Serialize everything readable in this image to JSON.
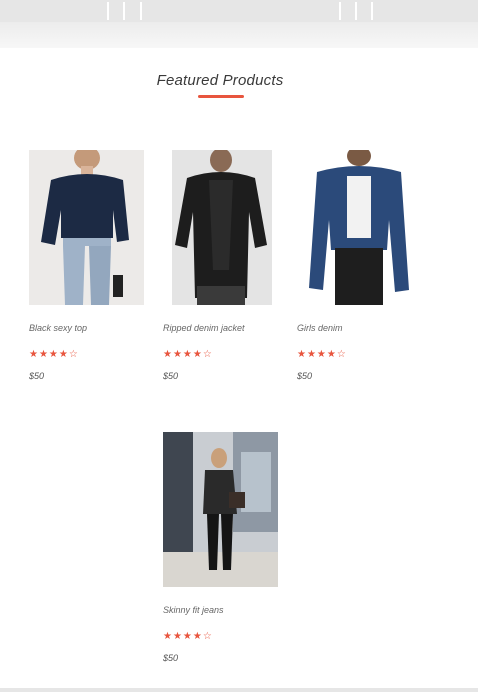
{
  "header": {
    "section_title": "Featured Products"
  },
  "products": [
    {
      "name": "Black sexy top",
      "price": "$50",
      "rating": 4,
      "max_rating": 5,
      "image": "black-sweater-jeans-photo"
    },
    {
      "name": "Ripped denim jacket",
      "price": "$50",
      "rating": 4,
      "max_rating": 5,
      "image": "black-denim-jacket-photo"
    },
    {
      "name": "Girls denim",
      "price": "$50",
      "rating": 4,
      "max_rating": 5,
      "image": "blue-denim-jacket-photo"
    },
    {
      "name": "Skinny fit jeans",
      "price": "$50",
      "rating": 4,
      "max_rating": 5,
      "image": "street-style-jeans-photo"
    }
  ],
  "colors": {
    "accent": "#e8553e",
    "topbar": "#e6e6e6"
  }
}
